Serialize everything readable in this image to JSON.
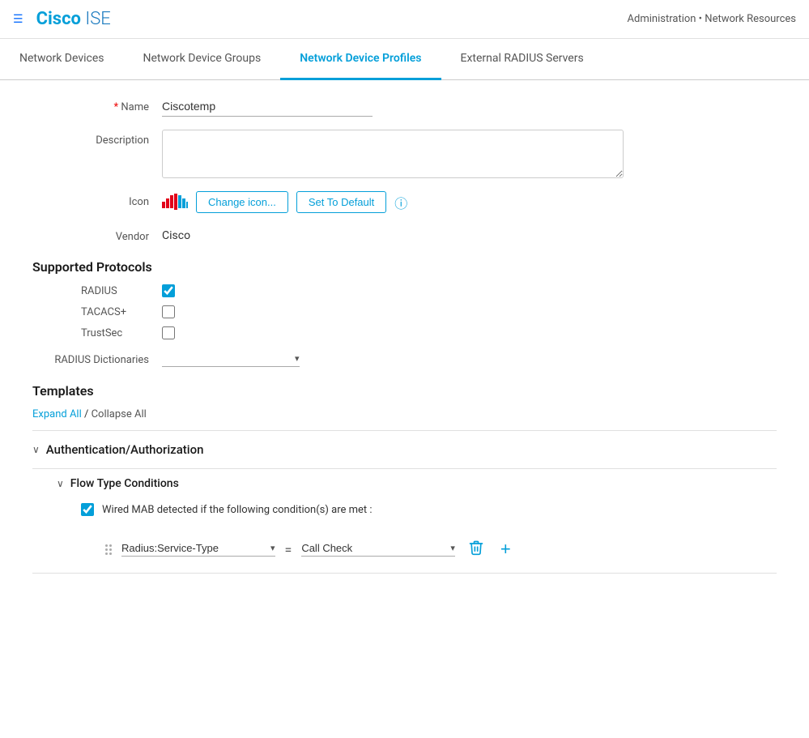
{
  "header": {
    "menu_icon": "☰",
    "logo_cisco": "Cisco",
    "logo_ise": " ISE",
    "breadcrumb": "Administration • Network Resources"
  },
  "nav": {
    "tabs": [
      {
        "id": "network-devices",
        "label": "Network Devices",
        "active": false
      },
      {
        "id": "network-device-groups",
        "label": "Network Device Groups",
        "active": false
      },
      {
        "id": "network-device-profiles",
        "label": "Network Device Profiles",
        "active": true
      },
      {
        "id": "external-radius-servers",
        "label": "External RADIUS Servers",
        "active": false
      }
    ]
  },
  "form": {
    "name_label": "* Name",
    "name_required_star": "*",
    "name_field_label": "Name",
    "name_value": "Ciscotemp",
    "description_label": "Description",
    "description_value": "",
    "icon_label": "Icon",
    "change_icon_btn": "Change icon...",
    "set_default_btn": "Set To Default",
    "vendor_label": "Vendor",
    "vendor_value": "Cisco"
  },
  "supported_protocols": {
    "section_title": "Supported Protocols",
    "protocols": [
      {
        "id": "radius",
        "label": "RADIUS",
        "checked": true
      },
      {
        "id": "tacacs",
        "label": "TACACS+",
        "checked": false
      },
      {
        "id": "trustsec",
        "label": "TrustSec",
        "checked": false
      }
    ]
  },
  "radius_dictionaries": {
    "label": "RADIUS Dictionaries",
    "value": ""
  },
  "templates": {
    "section_title": "Templates",
    "expand_all": "Expand All",
    "separator": " / ",
    "collapse_all": "Collapse All",
    "accordion_items": [
      {
        "id": "auth-authorization",
        "label": "Authentication/Authorization",
        "expanded": true
      },
      {
        "id": "flow-type-conditions",
        "label": "Flow Type Conditions",
        "expanded": true,
        "sub_items": [
          {
            "id": "wired-mab",
            "checkbox_label": "Wired MAB detected if the following condition(s) are met :",
            "checked": true,
            "condition_left": "Radius:Service-Type",
            "equals": "=",
            "condition_right": "Call Check"
          }
        ]
      }
    ]
  },
  "icons": {
    "hamburger": "☰",
    "info": "ⓘ",
    "chevron_down": "∨",
    "chevron_small": "⌄",
    "delete": "🗑",
    "add": "+"
  }
}
